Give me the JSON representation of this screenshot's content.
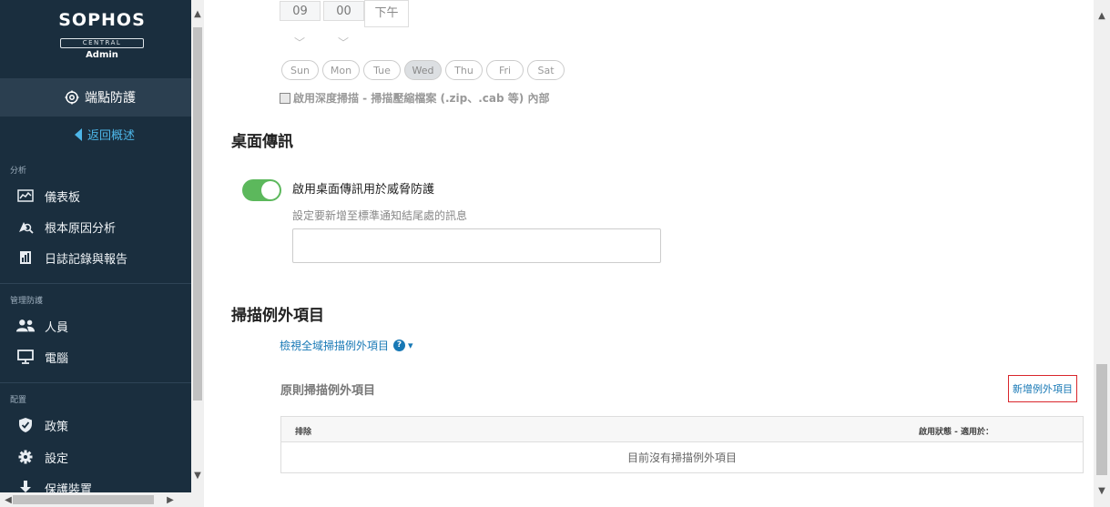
{
  "brand": {
    "name": "SOPHOS",
    "product": "CENTRAL",
    "role": "Admin"
  },
  "sidebar": {
    "section_title": "端點防護",
    "back_label": "返回概述",
    "groups": [
      {
        "label": "分析",
        "items": [
          {
            "label": "儀表板",
            "icon": "dashboard-icon"
          },
          {
            "label": "根本原因分析",
            "icon": "root-cause-icon"
          },
          {
            "label": "日誌記錄與報告",
            "icon": "report-icon"
          }
        ]
      },
      {
        "label": "管理防護",
        "items": [
          {
            "label": "人員",
            "icon": "people-icon"
          },
          {
            "label": "電腦",
            "icon": "computer-icon"
          }
        ]
      },
      {
        "label": "配置",
        "items": [
          {
            "label": "政策",
            "icon": "shield-icon"
          },
          {
            "label": "設定",
            "icon": "gear-icon"
          },
          {
            "label": "保護裝置",
            "icon": "download-icon"
          }
        ]
      }
    ]
  },
  "schedule": {
    "hour": "09",
    "minute": "00",
    "ampm": "下午",
    "days": [
      {
        "label": "Sun",
        "selected": false
      },
      {
        "label": "Mon",
        "selected": false
      },
      {
        "label": "Tue",
        "selected": false
      },
      {
        "label": "Wed",
        "selected": true
      },
      {
        "label": "Thu",
        "selected": false
      },
      {
        "label": "Fri",
        "selected": false
      },
      {
        "label": "Sat",
        "selected": false
      }
    ],
    "deep_scan_label": "啟用深度掃描 - 掃描壓縮檔案 (.zip、.cab 等) 內部"
  },
  "desktop_messaging": {
    "title": "桌面傳訊",
    "toggle_label": "啟用桌面傳訊用於威脅防護",
    "toggle_on": true,
    "field_label": "設定要新增至標準通知結尾處的訊息",
    "field_value": ""
  },
  "exclusions": {
    "title": "掃描例外項目",
    "global_link": "檢視全域掃描例外項目",
    "policy_title": "原則掃描例外項目",
    "add_button": "新增例外項目",
    "columns": [
      "排除",
      "啟用狀態 - 適用於："
    ],
    "empty_text": "目前沒有掃描例外項目"
  }
}
